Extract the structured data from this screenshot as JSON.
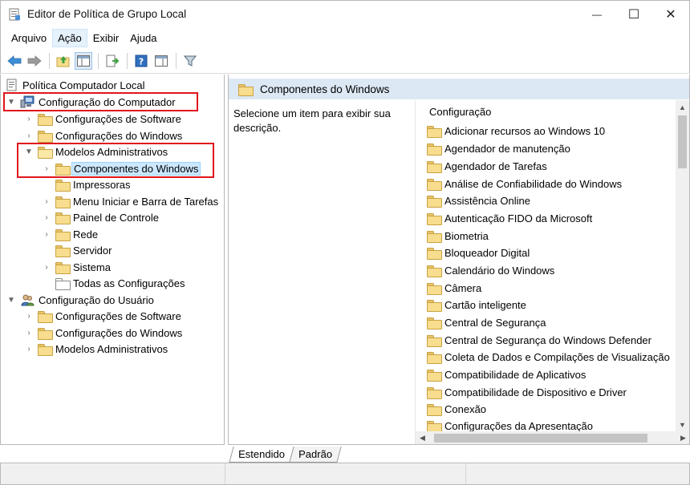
{
  "window": {
    "title": "Editor de Política de Grupo Local",
    "minimize": "—",
    "maximize": "☐",
    "close": "✕"
  },
  "menu": [
    {
      "label": "Arquivo",
      "active": false
    },
    {
      "label": "Ação",
      "active": true
    },
    {
      "label": "Exibir",
      "active": false
    },
    {
      "label": "Ajuda",
      "active": false
    }
  ],
  "toolbar": {
    "icons": [
      "back-arrow-icon",
      "forward-arrow-icon",
      "up-folder-icon",
      "show-hide-tree-icon",
      "export-list-icon",
      "help-icon",
      "properties-view-icon",
      "filter-icon"
    ]
  },
  "tree": {
    "root": "Política Computador Local",
    "computer": "Configuração do Computador",
    "computer_software": "Configurações de Software",
    "computer_windows": "Configurações do Windows",
    "admin_templates": "Modelos Administrativos",
    "windows_components": "Componentes do Windows",
    "printers": "Impressoras",
    "start_menu": "Menu Iniciar e Barra de Tarefas",
    "control_panel": "Painel de Controle",
    "network": "Rede",
    "server": "Servidor",
    "system": "Sistema",
    "all_settings": "Todas as Configurações",
    "user": "Configuração do Usuário",
    "user_software": "Configurações de Software",
    "user_windows": "Configurações do Windows",
    "user_admin_templates": "Modelos Administrativos"
  },
  "details": {
    "header": "Componentes do Windows",
    "description": "Selecione um item para exibir sua descrição.",
    "column": "Configuração",
    "items": [
      "Adicionar recursos ao Windows 10",
      "Agendador de manutenção",
      "Agendador de Tarefas",
      "Análise de Confiabilidade do Windows",
      "Assistência Online",
      "Autenticação FIDO da Microsoft",
      "Biometria",
      "Bloqueador Digital",
      "Calendário do Windows",
      "Câmera",
      "Cartão inteligente",
      "Central de Segurança",
      "Central de Segurança do Windows Defender",
      "Coleta de Dados e Compilações de Visualização",
      "Compatibilidade de Aplicativos",
      "Compatibilidade de Dispositivo e Driver",
      "Conexão",
      "Configurações da Apresentação"
    ]
  },
  "tabs": [
    {
      "label": "Estendido",
      "active": true
    },
    {
      "label": "Padrão",
      "active": false
    }
  ],
  "colors": {
    "highlight_box": "#e0151c",
    "header_band": "#dce8f4",
    "selection": "#cce8ff",
    "folder": "#f7dd8d"
  }
}
